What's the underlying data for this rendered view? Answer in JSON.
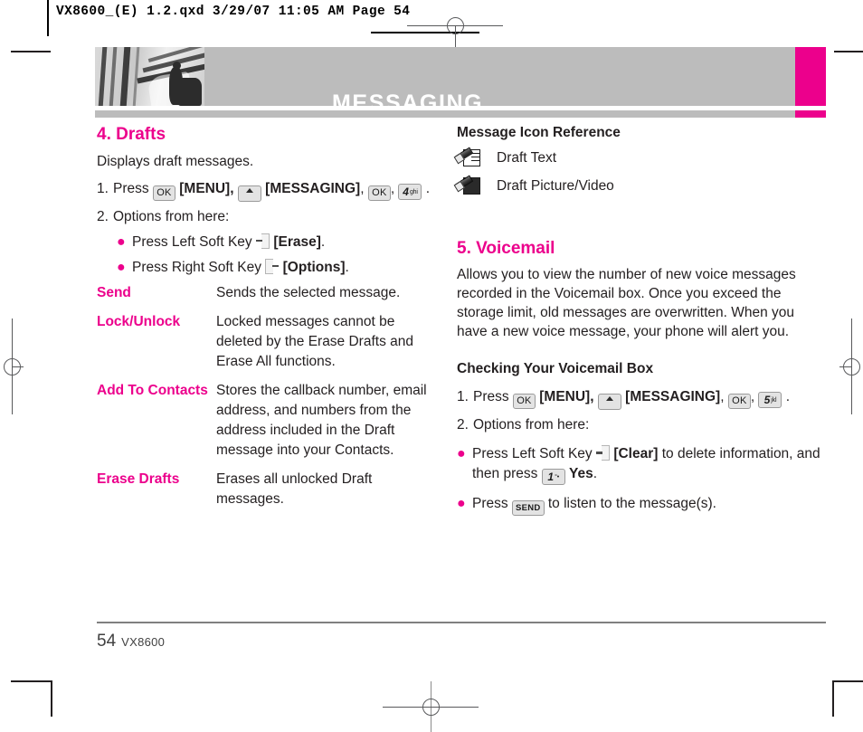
{
  "slug": "VX8600_(E) 1.2.qxd  3/29/07  11:05 AM  Page 54",
  "header": {
    "title": "MESSAGING",
    "accent_color": "#ec008c",
    "band_color": "#bcbcbc"
  },
  "left_column": {
    "section": {
      "heading": "4. Drafts",
      "intro": "Displays draft messages."
    },
    "steps": [
      {
        "num": "1.",
        "press_label": "Press",
        "key_ok": "OK",
        "menu_label": "[MENU],",
        "nav_icon": "up-arrow-key-icon",
        "messaging_label": "[MESSAGING]",
        "comma": ",",
        "key_ok2": "OK",
        "num_key": "4",
        "num_key_sub": "ghi",
        "period": "."
      },
      {
        "num": "2.",
        "text": "Options from here:"
      }
    ],
    "bullets": [
      {
        "prefix": "Press Left Soft Key",
        "softkey": "left-soft-key-icon",
        "label": "[Erase]",
        "suffix": "."
      },
      {
        "prefix": "Press Right Soft Key",
        "softkey": "right-soft-key-icon",
        "label": "[Options]",
        "suffix": "."
      }
    ],
    "definitions": [
      {
        "term": "Send",
        "desc": "Sends the selected message."
      },
      {
        "term": "Lock/Unlock",
        "desc": "Locked messages cannot be deleted by the Erase Drafts and Erase All functions."
      },
      {
        "term": "Add To Contacts",
        "desc": "Stores the callback number, email address, and numbers from the address included in the Draft message into your Contacts."
      },
      {
        "term": "Erase Drafts",
        "desc": "Erases all unlocked Draft messages."
      }
    ]
  },
  "right_column": {
    "icon_reference": {
      "heading": "Message Icon Reference",
      "items": [
        {
          "icon": "draft-text-icon",
          "label": "Draft Text"
        },
        {
          "icon": "draft-picture-video-icon",
          "label": "Draft Picture/Video"
        }
      ]
    },
    "section": {
      "heading": "5. Voicemail",
      "body": "Allows you to view the number of new voice messages recorded in the Voicemail box. Once you exceed the storage limit, old messages are overwritten. When you have a new voice message, your phone will alert you."
    },
    "subsection": {
      "heading": "Checking Your Voicemail Box",
      "steps": [
        {
          "num": "1.",
          "press_label": "Press",
          "key_ok": "OK",
          "menu_label": "[MENU],",
          "nav_icon": "up-arrow-key-icon",
          "messaging_label": "[MESSAGING]",
          "comma": ",",
          "key_ok2": "OK",
          "num_key": "5",
          "num_key_sub": "jkl",
          "period": "."
        },
        {
          "num": "2.",
          "text": "Options from here:"
        }
      ],
      "bullets": [
        {
          "prefix": "Press Left Soft Key",
          "softkey": "left-soft-key-icon",
          "label": "[Clear]",
          "mid": "to delete information, and then press",
          "num_key": "1",
          "num_key_sub": "°•",
          "confirm": "Yes",
          "suffix": "."
        },
        {
          "prefix": "Press",
          "send_key": "SEND",
          "mid": "to listen to the message(s).",
          "label": "",
          "suffix": ""
        }
      ]
    }
  },
  "footer": {
    "page_number": "54",
    "model": "VX8600"
  }
}
